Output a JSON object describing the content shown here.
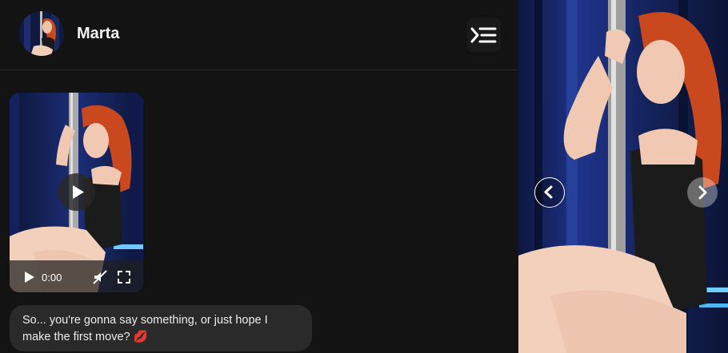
{
  "header": {
    "character_name": "Marta"
  },
  "media": {
    "video_time": "0:00"
  },
  "messages": [
    {
      "text": "So... you're gonna say something, or just hope I make the first move? 💋"
    }
  ],
  "colors": {
    "background": "#131313",
    "bubble": "#2a2a2a",
    "hair": "#c9481e",
    "curtain": "#16245a"
  },
  "icons": [
    "menu-icon",
    "play-icon",
    "mute-icon",
    "fullscreen-icon",
    "chevron-left-icon",
    "chevron-right-icon"
  ]
}
